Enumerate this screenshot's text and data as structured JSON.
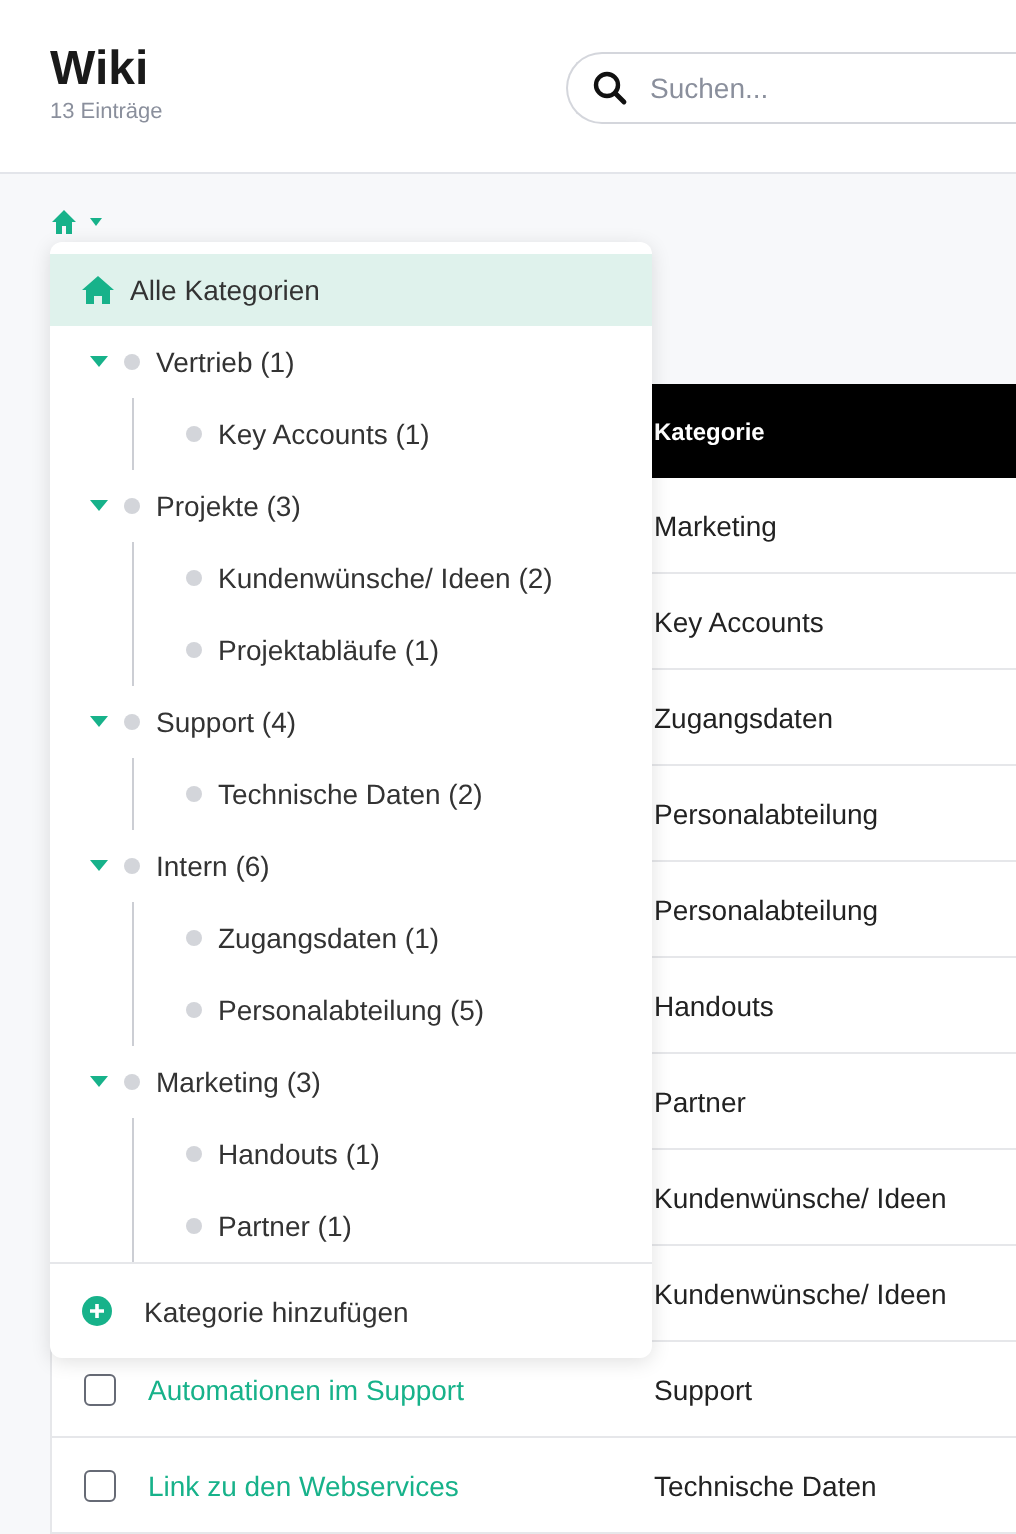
{
  "header": {
    "title": "Wiki",
    "subtitle": "13 Einträge",
    "search": {
      "placeholder": "Suchen..."
    }
  },
  "category_menu": {
    "all": {
      "label": "Alle Kategorien",
      "selected": true
    },
    "categories": [
      {
        "label": "Vertrieb (1)",
        "expanded": true,
        "children": [
          {
            "label": "Key Accounts (1)"
          }
        ]
      },
      {
        "label": "Projekte (3)",
        "expanded": true,
        "children": [
          {
            "label": "Kundenwünsche/ Ideen (2)"
          },
          {
            "label": "Projektabläufe (1)"
          }
        ]
      },
      {
        "label": "Support (4)",
        "expanded": true,
        "children": [
          {
            "label": "Technische Daten (2)"
          }
        ]
      },
      {
        "label": "Intern (6)",
        "expanded": true,
        "children": [
          {
            "label": "Zugangsdaten (1)"
          },
          {
            "label": "Personalabteilung (5)"
          }
        ]
      },
      {
        "label": "Marketing (3)",
        "expanded": true,
        "children": [
          {
            "label": "Handouts (1)"
          },
          {
            "label": "Partner (1)"
          }
        ]
      }
    ],
    "add_label": "Kategorie hinzufügen"
  },
  "table": {
    "columns": [
      "Kategorie"
    ],
    "rows": [
      {
        "category": "Marketing"
      },
      {
        "category": "Key Accounts"
      },
      {
        "category": "Zugangsdaten"
      },
      {
        "category": "Personalabteilung"
      },
      {
        "category": "Personalabteilung"
      },
      {
        "category": "Handouts"
      },
      {
        "category": "Partner"
      },
      {
        "category": "Kundenwünsche/ Ideen"
      },
      {
        "category": "Kundenwünsche/ Ideen"
      },
      {
        "title": "Automationen im Support",
        "checked": false,
        "category": "Support"
      },
      {
        "title": "Link zu den Webservices",
        "checked": false,
        "category": "Technische Daten"
      }
    ]
  }
}
